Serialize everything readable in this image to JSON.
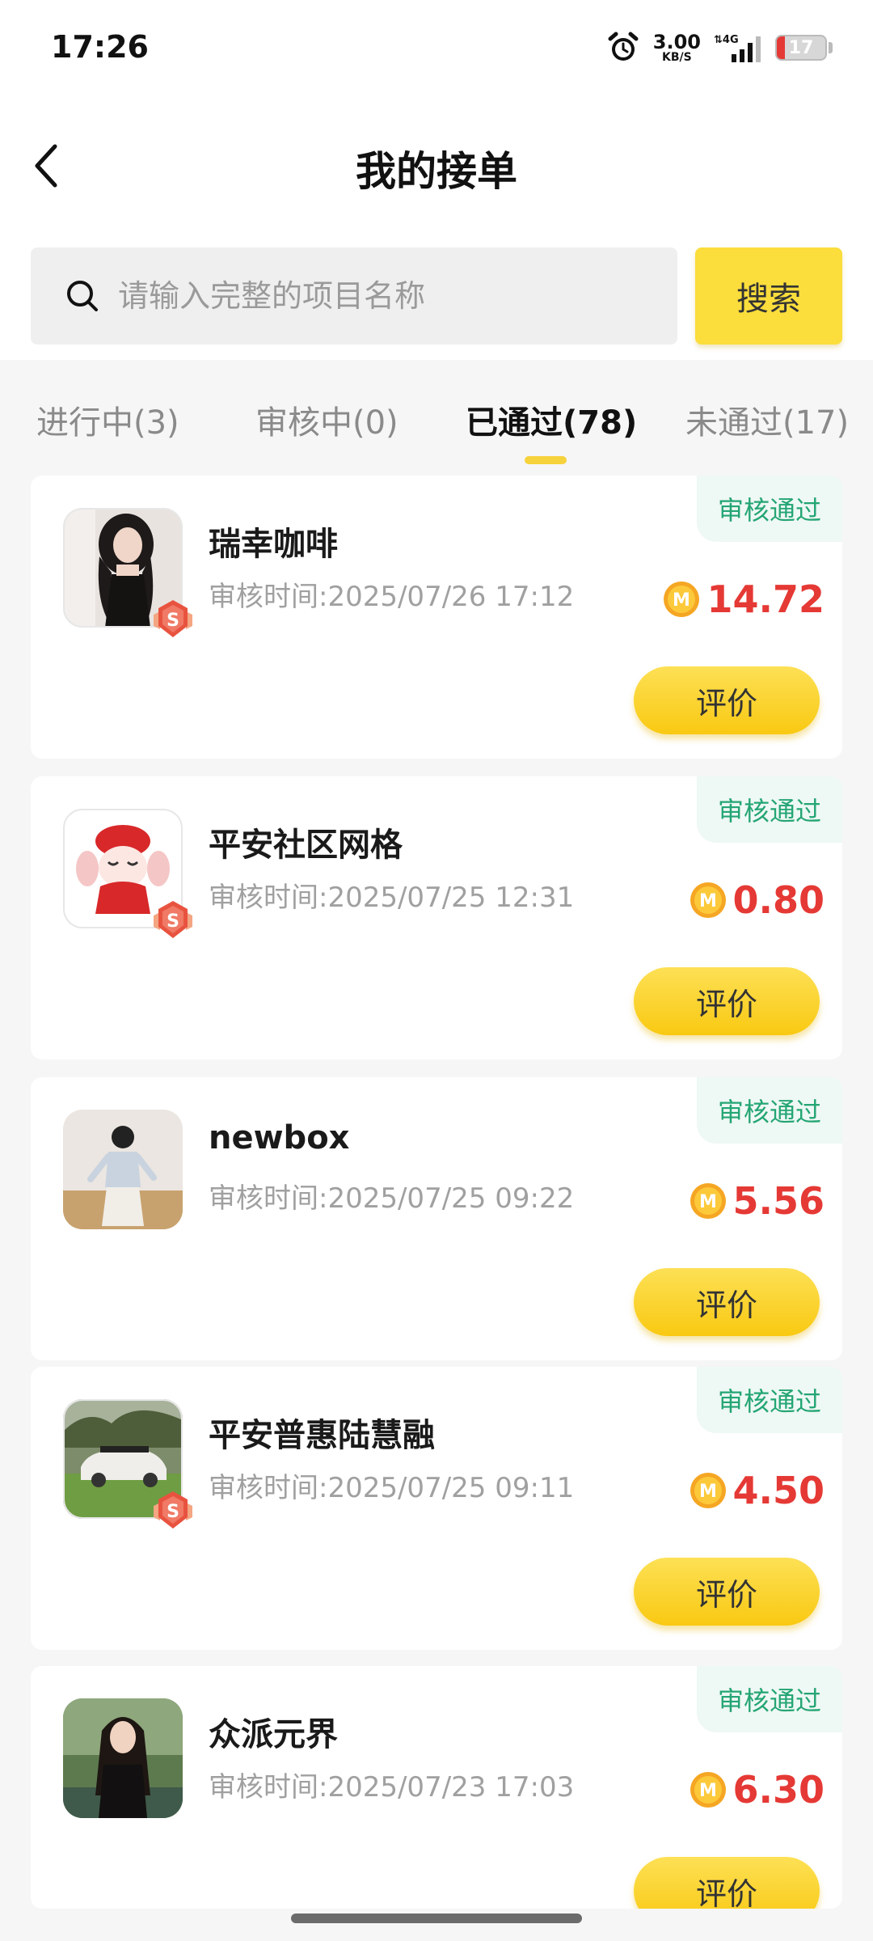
{
  "status_bar": {
    "time": "17:26",
    "net_speed": "3.00",
    "net_unit": "KB/S",
    "network": "4G",
    "battery": "17"
  },
  "header": {
    "title": "我的接单"
  },
  "search": {
    "placeholder": "请输入完整的项目名称",
    "button_label": "搜索"
  },
  "tabs": [
    {
      "label": "进行中(3)",
      "active": false
    },
    {
      "label": "审核中(0)",
      "active": false
    },
    {
      "label": "已通过(78)",
      "active": true
    },
    {
      "label": "未通过(17)",
      "active": false
    }
  ],
  "orders": [
    {
      "name": "瑞幸咖啡",
      "time": "审核时间:2025/07/26 17:12",
      "amount": "14.72",
      "status": "审核通过",
      "action": "评价"
    },
    {
      "name": "平安社区网格",
      "time": "审核时间:2025/07/25 12:31",
      "amount": "0.80",
      "status": "审核通过",
      "action": "评价"
    },
    {
      "name": "newbox",
      "time": "审核时间:2025/07/25 09:22",
      "amount": "5.56",
      "status": "审核通过",
      "action": "评价"
    },
    {
      "name": "平安普惠陆慧融",
      "time": "审核时间:2025/07/25 09:11",
      "amount": "4.50",
      "status": "审核通过",
      "action": "评价"
    },
    {
      "name": "众派元界",
      "time": "审核时间:2025/07/23 17:03",
      "amount": "6.30",
      "status": "审核通过",
      "action": "评价"
    }
  ],
  "colors": {
    "accent": "#fbdd3c",
    "price": "#e53935",
    "status_text": "#24a574"
  },
  "icons": {
    "back": "chevron-left-icon",
    "search": "search-icon",
    "coin": "coin-icon",
    "level_badge": "s-level-badge-icon",
    "alarm": "alarm-icon"
  }
}
